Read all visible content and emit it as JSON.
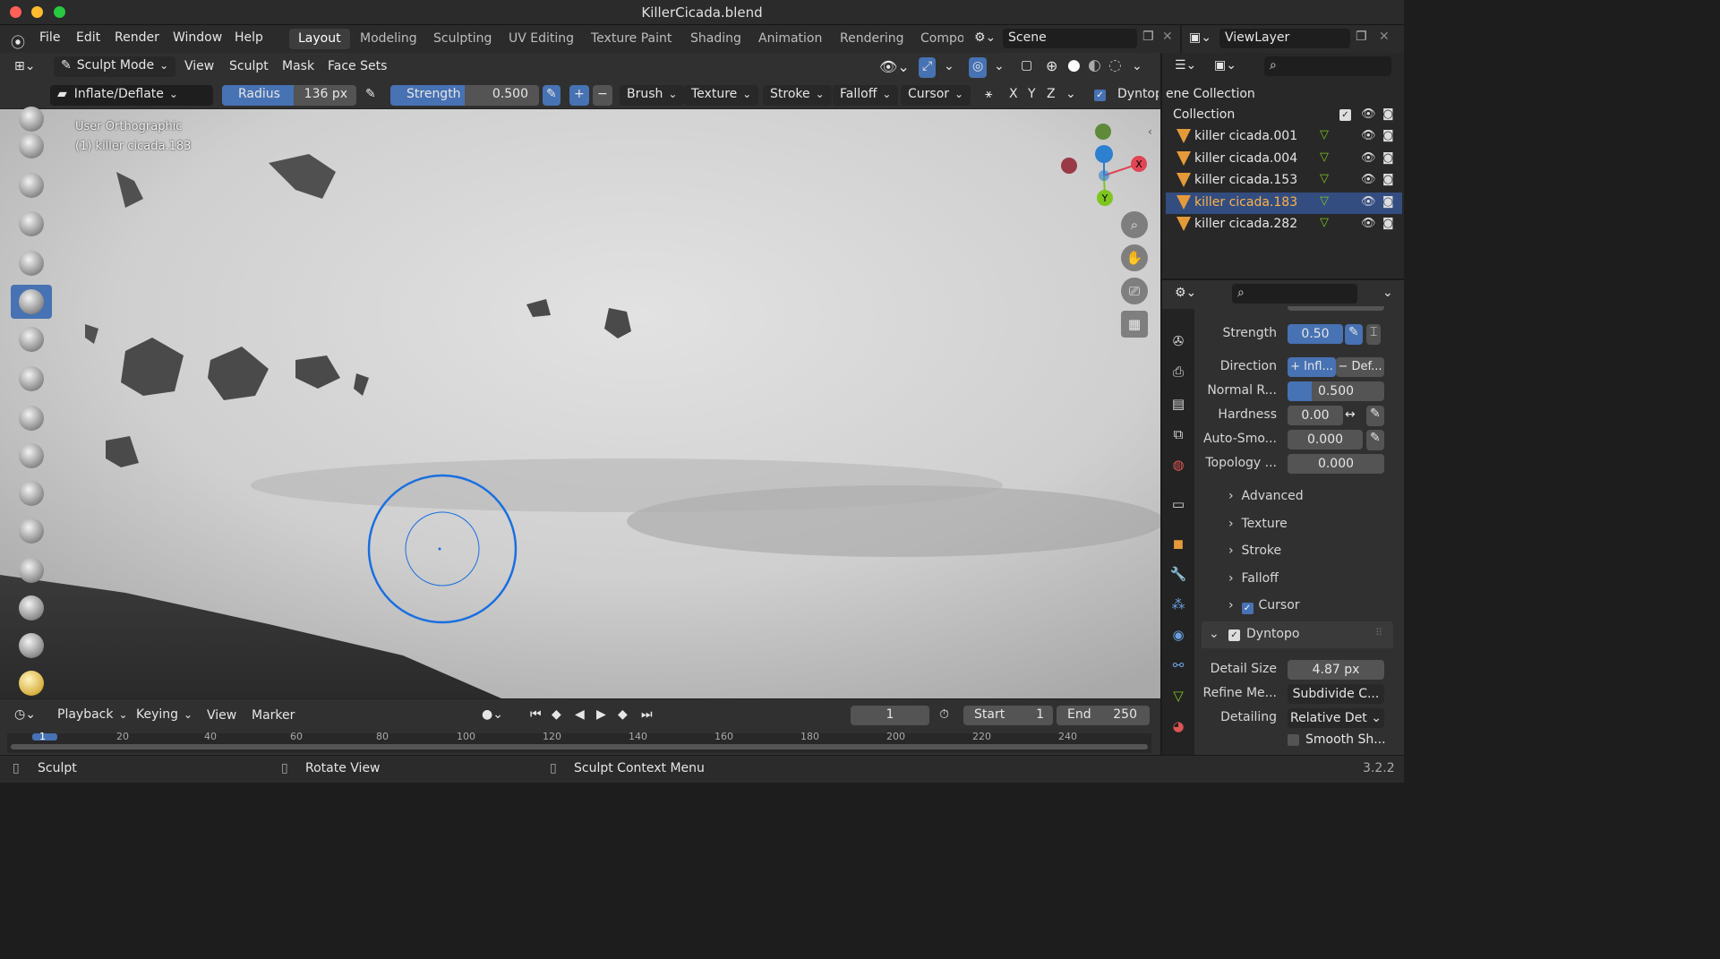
{
  "window": {
    "title": "KillerCicada.blend"
  },
  "menu": {
    "items": [
      "File",
      "Edit",
      "Render",
      "Window",
      "Help"
    ]
  },
  "workspaces": {
    "tabs": [
      "Layout",
      "Modeling",
      "Sculpting",
      "UV Editing",
      "Texture Paint",
      "Shading",
      "Animation",
      "Rendering",
      "Compo"
    ],
    "active": "Layout"
  },
  "scene": {
    "name": "Scene"
  },
  "viewlayer": {
    "name": "ViewLayer"
  },
  "header": {
    "mode": "Sculpt Mode",
    "menus": [
      "View",
      "Sculpt",
      "Mask",
      "Face Sets"
    ]
  },
  "toolsettings": {
    "brush_name": "Inflate/Deflate",
    "radius_label": "Radius",
    "radius_value": "136 px",
    "strength_label": "Strength",
    "strength_value": "0.500",
    "dropdowns": [
      "Brush",
      "Texture",
      "Stroke",
      "Falloff",
      "Cursor"
    ],
    "axes": [
      "X",
      "Y",
      "Z"
    ],
    "dyntopo_label": "Dyntop"
  },
  "viewport": {
    "view_name": "User Orthographic",
    "object_label": "(1) killer cicada.183",
    "gizmo": {
      "x": "X",
      "y": "Y"
    }
  },
  "outliner": {
    "scene_collection": "ene Collection",
    "collection": "Collection",
    "objects": [
      "killer cicada.001",
      "killer cicada.004",
      "killer cicada.153",
      "killer cicada.183",
      "killer cicada.282"
    ],
    "selected": "killer cicada.183"
  },
  "properties": {
    "strength_label": "Strength",
    "strength_value": "0.50",
    "direction_label": "Direction",
    "direction_infl": "+ Infl...",
    "direction_def": "− Def...",
    "normal_label": "Normal R...",
    "normal_value": "0.500",
    "hardness_label": "Hardness",
    "hardness_value": "0.00",
    "autosmooth_label": "Auto-Smo...",
    "autosmooth_value": "0.000",
    "topology_label": "Topology ...",
    "topology_value": "0.000",
    "sections": [
      "Advanced",
      "Texture",
      "Stroke",
      "Falloff",
      "Cursor"
    ],
    "dyntopo_label": "Dyntopo",
    "detail_size_label": "Detail Size",
    "detail_size_value": "4.87 px",
    "refine_label": "Refine Me...",
    "refine_value": "Subdivide C...",
    "detailing_label": "Detailing",
    "detailing_value": "Relative Det",
    "smooth_label": "Smooth Sh..."
  },
  "timeline": {
    "menus": [
      "Playback",
      "Keying",
      "View",
      "Marker"
    ],
    "current_frame": "1",
    "start_label": "Start",
    "start_value": "1",
    "end_label": "End",
    "end_value": "250",
    "ruler": [
      "1",
      "20",
      "40",
      "60",
      "80",
      "100",
      "120",
      "140",
      "160",
      "180",
      "200",
      "220",
      "240"
    ]
  },
  "status": {
    "left": "Sculpt",
    "middle": "Rotate View",
    "right": "Sculpt Context Menu",
    "version": "3.2.2"
  },
  "colors": {
    "accent": "#4772b3",
    "brush_circle": "#1a6fe0",
    "object_icon": "#e59a3a"
  }
}
